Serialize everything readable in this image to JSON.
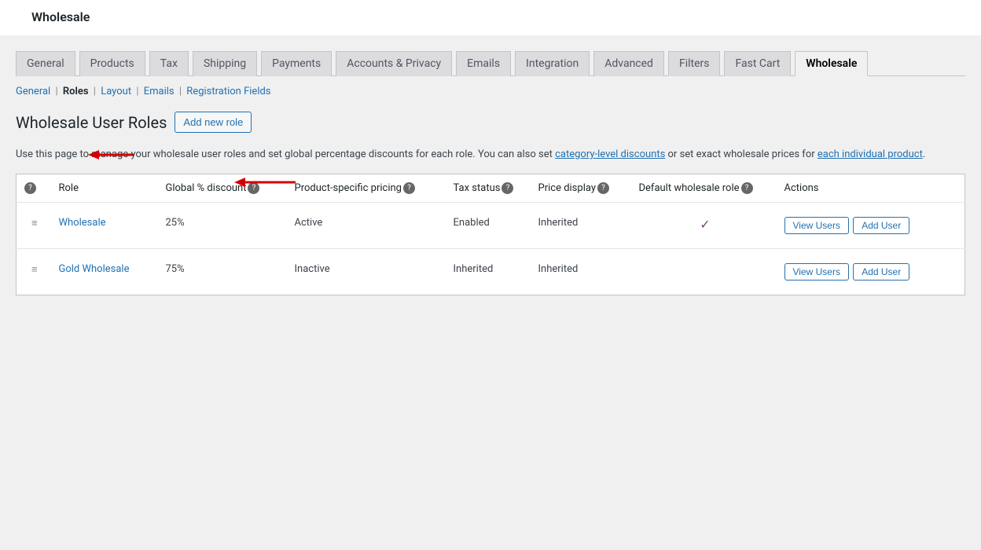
{
  "top_title": "Wholesale",
  "tabs": [
    "General",
    "Products",
    "Tax",
    "Shipping",
    "Payments",
    "Accounts & Privacy",
    "Emails",
    "Integration",
    "Advanced",
    "Filters",
    "Fast Cart",
    "Wholesale"
  ],
  "active_tab": "Wholesale",
  "subnav": {
    "general": "General",
    "roles": "Roles",
    "layout": "Layout",
    "emails": "Emails",
    "registration": "Registration Fields"
  },
  "heading": "Wholesale User Roles",
  "add_button": "Add new role",
  "description": {
    "part1": "Use this page to manage your wholesale user roles and set global percentage discounts for each role. You can also set ",
    "link1": "category-level discounts",
    "part2": " or set exact wholesale prices for ",
    "link2": "each individual product",
    "part3": "."
  },
  "columns": {
    "role": "Role",
    "global": "Global % discount",
    "psp": "Product-specific pricing",
    "tax": "Tax status",
    "price": "Price display",
    "default": "Default wholesale role",
    "actions": "Actions"
  },
  "rows": [
    {
      "role": "Wholesale",
      "discount": "25%",
      "psp": "Active",
      "tax": "Enabled",
      "price": "Inherited",
      "default": true
    },
    {
      "role": "Gold Wholesale",
      "discount": "75%",
      "psp": "Inactive",
      "tax": "Inherited",
      "price": "Inherited",
      "default": false
    }
  ],
  "action_labels": {
    "view": "View Users",
    "add": "Add User"
  }
}
